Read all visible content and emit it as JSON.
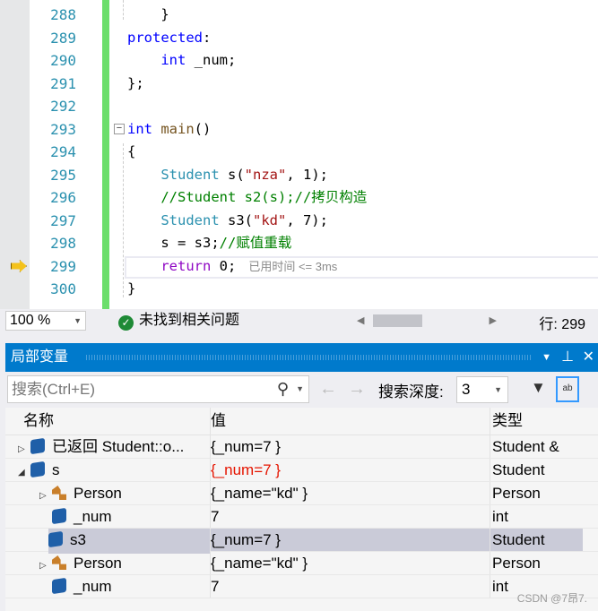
{
  "editor": {
    "lines": [
      {
        "n": "288",
        "indent": "    ",
        "parts": [
          [
            "",
            "}"
          ]
        ]
      },
      {
        "n": "289",
        "indent": "",
        "parts": [
          [
            "kw",
            "protected"
          ],
          [
            "",
            ":"
          ]
        ]
      },
      {
        "n": "290",
        "indent": "    ",
        "parts": [
          [
            "kw",
            "int"
          ],
          [
            "",
            " _num;"
          ]
        ]
      },
      {
        "n": "291",
        "indent": "",
        "parts": [
          [
            "",
            "};"
          ]
        ]
      },
      {
        "n": "292",
        "indent": "",
        "parts": []
      },
      {
        "n": "293",
        "indent": "",
        "parts": [
          [
            "kw",
            "int"
          ],
          [
            "",
            " "
          ],
          [
            "fn",
            "main"
          ],
          [
            "",
            "()"
          ]
        ]
      },
      {
        "n": "294",
        "indent": "",
        "parts": [
          [
            "",
            "{"
          ]
        ]
      },
      {
        "n": "295",
        "indent": "    ",
        "parts": [
          [
            "ty",
            "Student"
          ],
          [
            "",
            " s("
          ],
          [
            "str",
            "\"nza\""
          ],
          [
            "",
            ", 1);"
          ]
        ]
      },
      {
        "n": "296",
        "indent": "    ",
        "parts": [
          [
            "cm",
            "//Student s2(s);//拷贝构造"
          ]
        ]
      },
      {
        "n": "297",
        "indent": "    ",
        "parts": [
          [
            "ty",
            "Student"
          ],
          [
            "",
            " s3("
          ],
          [
            "str",
            "\"kd\""
          ],
          [
            "",
            ", 7);"
          ]
        ]
      },
      {
        "n": "298",
        "indent": "    ",
        "parts": [
          [
            "",
            "s = s3;"
          ],
          [
            "cm",
            "//赋值重载"
          ]
        ]
      },
      {
        "n": "299",
        "indent": "    ",
        "parts": [
          [
            "rt",
            "return"
          ],
          [
            "",
            " 0;"
          ]
        ]
      },
      {
        "n": "300",
        "indent": "",
        "parts": [
          [
            "",
            "}"
          ]
        ]
      }
    ],
    "elapsed_hint": "已用时间 <= 3ms",
    "current_line_icon": "arrow-right-icon"
  },
  "status": {
    "zoom": "100 %",
    "issues": "未找到相关问题",
    "row": "行: 299"
  },
  "panel": {
    "title": "局部变量",
    "search_placeholder": "搜索(Ctrl+E)",
    "depth_label": "搜索深度:",
    "depth": "3",
    "columns": [
      "名称",
      "值",
      "类型"
    ],
    "rows": [
      {
        "tw": "▷",
        "icon": "cube",
        "name": "已返回 Student::o...",
        "value": "{_num=7 }",
        "type": "Student &",
        "lvl": 0
      },
      {
        "tw": "◢",
        "icon": "cube",
        "name": "s",
        "value": "{_num=7 }",
        "type": "Student",
        "lvl": 0,
        "changed": true
      },
      {
        "tw": "▷",
        "icon": "class",
        "name": "Person",
        "value": "{_name=\"kd\" }",
        "type": "Person",
        "lvl": 1
      },
      {
        "tw": "",
        "icon": "field",
        "name": "_num",
        "value": "7",
        "type": "int",
        "lvl": 1
      },
      {
        "tw": "◢",
        "icon": "cube",
        "name": "s3",
        "value": "{_num=7 }",
        "type": "Student",
        "lvl": 0,
        "selected": true
      },
      {
        "tw": "▷",
        "icon": "class",
        "name": "Person",
        "value": "{_name=\"kd\" }",
        "type": "Person",
        "lvl": 1
      },
      {
        "tw": "",
        "icon": "field",
        "name": "_num",
        "value": "7",
        "type": "int",
        "lvl": 1
      }
    ]
  },
  "watermark": "CSDN @7昂7.",
  "colors": {
    "accent": "#007acc",
    "changed": "#e51400",
    "gutter_green": "#6bde6b"
  }
}
